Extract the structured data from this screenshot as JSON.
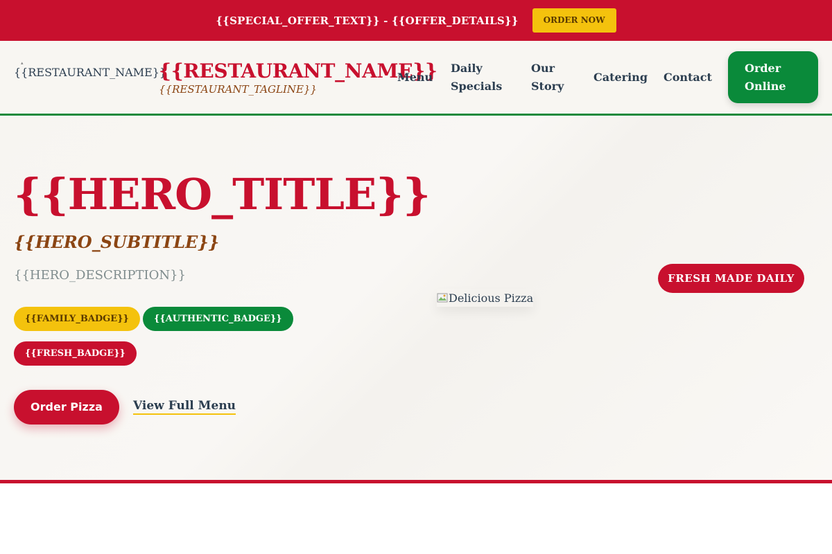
{
  "promo": {
    "text": "{{SPECIAL_OFFER_TEXT}} - {{OFFER_DETAILS}}",
    "button_label": "ORDER NOW"
  },
  "header": {
    "logo_alt": "{{RESTAURANT_NAME}}",
    "brand_name": "{{RESTAURANT_NAME}}",
    "tagline": "{{RESTAURANT_TAGLINE}}",
    "nav": {
      "menu": "Menu",
      "specials": "Daily Specials",
      "story": "Our Story",
      "catering": "Catering",
      "contact": "Contact"
    },
    "order_online": "Order Online"
  },
  "hero": {
    "title": "{{HERO_TITLE}}",
    "subtitle": "{{HERO_SUBTITLE}}",
    "description": "{{HERO_DESCRIPTION}}",
    "badges": {
      "family": "{{FAMILY_BADGE}}",
      "authentic": "{{AUTHENTIC_BADGE}}",
      "fresh": "{{FRESH_BADGE}}"
    },
    "primary_cta": "Order Pizza",
    "secondary_cta": "View Full Menu",
    "image_alt": "Delicious Pizza",
    "fresh_tag": "FRESH MADE DAILY"
  },
  "colors": {
    "brand_red": "#c8102e",
    "brand_green": "#0a8a3a",
    "brand_yellow": "#f4c20d",
    "tagline_brown": "#8b4513"
  }
}
